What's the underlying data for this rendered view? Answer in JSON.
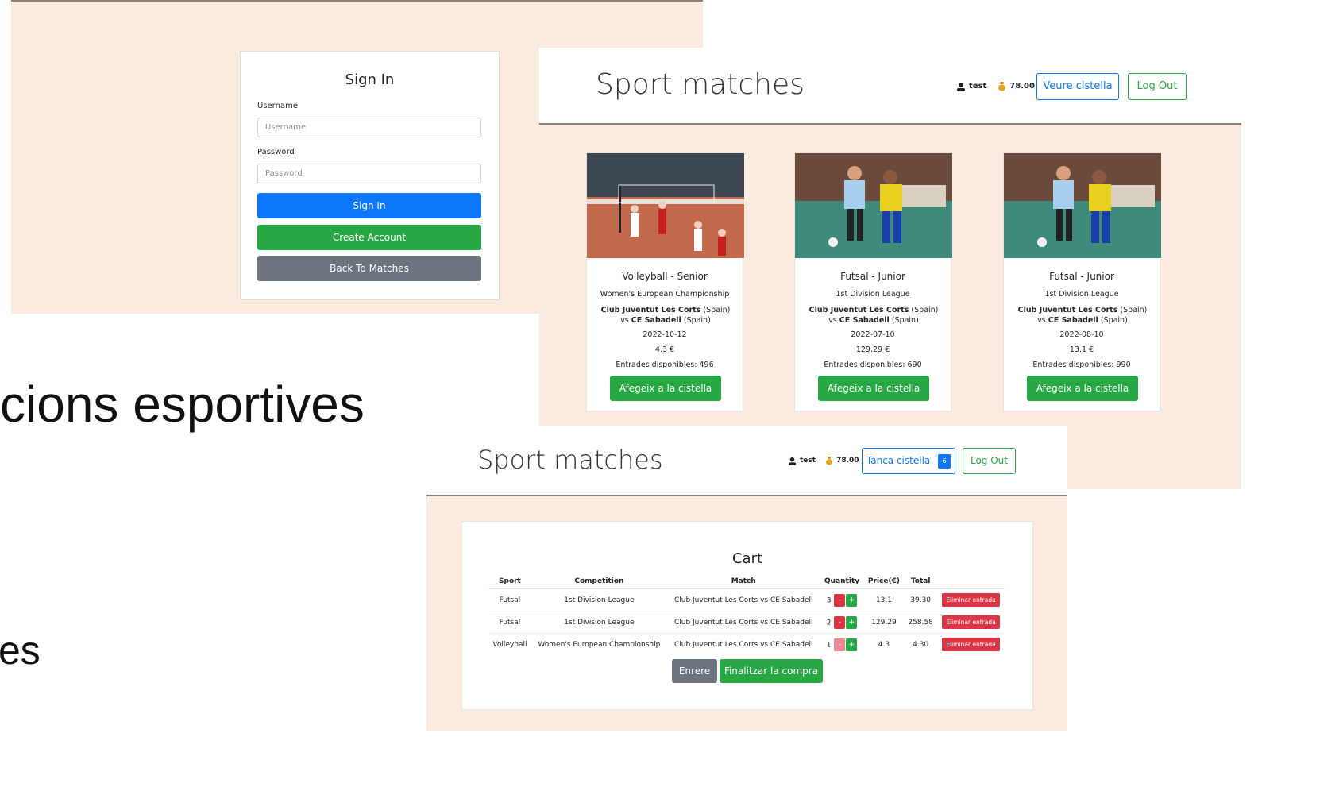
{
  "slide": {
    "text_line1": "cions esportives",
    "text_line2": "es"
  },
  "login": {
    "title": "Sign In",
    "username_label": "Username",
    "username_placeholder": "Username",
    "password_label": "Password",
    "password_placeholder": "Password",
    "signin_button": "Sign In",
    "create_button": "Create Account",
    "back_button": "Back To Matches",
    "colors": {
      "primary": "#0d77fb",
      "success": "#28a745",
      "secondary": "#6c757d"
    }
  },
  "matches": {
    "title": "Sport matches",
    "user": "test",
    "balance": "78.00",
    "cart_button": "Veure cistella",
    "logout_button": "Log Out",
    "cards": [
      {
        "title": "Volleyball - Senior",
        "competition": "Women's European Championship",
        "team1": "Club Juventut Les Corts",
        "team1_country": "(Spain)",
        "vs": "vs",
        "team2": "CE Sabadell",
        "team2_country": "(Spain)",
        "date": "2022-10-12",
        "price": "4.3 €",
        "available": "Entrades disponibles: 496",
        "button": "Afegeix a la cistella",
        "image_icon": "volleyball-photo"
      },
      {
        "title": "Futsal - Junior",
        "competition": "1st Division League",
        "team1": "Club Juventut Les Corts",
        "team1_country": "(Spain)",
        "vs": "vs",
        "team2": "CE Sabadell",
        "team2_country": "(Spain)",
        "date": "2022-07-10",
        "price": "129.29 €",
        "available": "Entrades disponibles: 690",
        "button": "Afegeix a la cistella",
        "image_icon": "futsal-photo"
      },
      {
        "title": "Futsal - Junior",
        "competition": "1st Division League",
        "team1": "Club Juventut Les Corts",
        "team1_country": "(Spain)",
        "vs": "vs",
        "team2": "CE Sabadell",
        "team2_country": "(Spain)",
        "date": "2022-08-10",
        "price": "13.1 €",
        "available": "Entrades disponibles: 990",
        "button": "Afegeix a la cistella",
        "image_icon": "futsal-photo"
      }
    ]
  },
  "cart": {
    "title": "Sport matches",
    "user": "test",
    "balance": "78.00",
    "cart_button": "Tanca cistella",
    "cart_count": "6",
    "logout_button": "Log Out",
    "heading": "Cart",
    "columns": [
      "Sport",
      "Competition",
      "Match",
      "Quantity",
      "Price(€)",
      "Total"
    ],
    "rows": [
      {
        "sport": "Futsal",
        "competition": "1st Division League",
        "match": "Club Juventut Les Corts vs CE Sabadell",
        "quantity": "3",
        "price": "13.1",
        "total": "39.30",
        "delete": "Eliminar entrada"
      },
      {
        "sport": "Futsal",
        "competition": "1st Division League",
        "match": "Club Juventut Les Corts vs CE Sabadell",
        "quantity": "2",
        "price": "129.29",
        "total": "258.58",
        "delete": "Eliminar entrada"
      },
      {
        "sport": "Volleyball",
        "competition": "Women's European Championship",
        "match": "Club Juventut Les Corts vs CE Sabadell",
        "quantity": "1",
        "price": "4.3",
        "total": "4.30",
        "delete": "Eliminar entrada"
      }
    ],
    "minus": "-",
    "plus": "+",
    "back_button": "Enrere",
    "checkout_button": "Finalitzar la compra"
  }
}
